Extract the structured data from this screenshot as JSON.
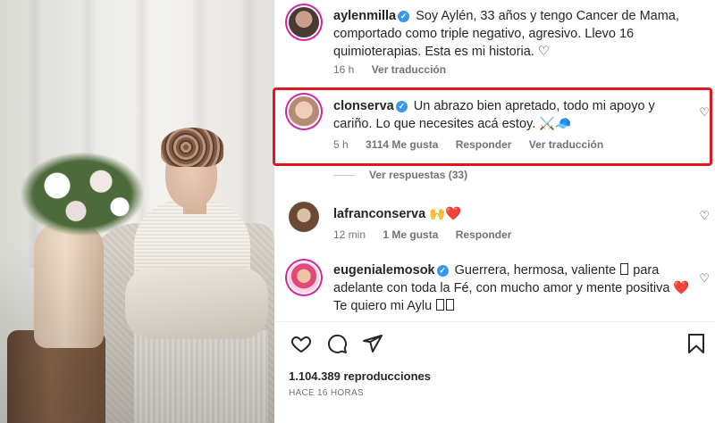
{
  "comments": [
    {
      "username": "aylenmilla",
      "verified": true,
      "text": "Soy Aylén, 33 años y tengo Cancer de Mama, comportado como triple negativo, agresivo. Llevo 16 quimioterapias. Esta es mi historia. ♡",
      "time": "16 h",
      "translate": "Ver traducción"
    },
    {
      "username": "clonserva",
      "verified": true,
      "text": "Un abrazo bien apretado, todo mi apoyo y cariño. Lo que necesites acá estoy. ⚔️🧢",
      "time": "5 h",
      "likes": "3114 Me gusta",
      "reply": "Responder",
      "translate": "Ver traducción",
      "replies_link": "Ver respuestas (33)"
    },
    {
      "username": "lafranconserva",
      "verified": false,
      "text": "🙌❤️",
      "time": "12 min",
      "likes": "1 Me gusta",
      "reply": "Responder"
    },
    {
      "username": "eugenialemosok",
      "verified": true,
      "text_main": "Guerrera, hermosa, valiente",
      "text_rest": "para adelante con toda la Fé, con mucho amor y mente positiva ❤️ Te quiero mi Aylu"
    }
  ],
  "stats": {
    "views": "1.104.389 reproducciones",
    "posted": "HACE 16 HORAS"
  },
  "icons": {
    "like": "heart-outline-icon",
    "comment": "speech-bubble-icon",
    "share": "paper-plane-icon",
    "save": "bookmark-icon"
  },
  "colors": {
    "highlight": "#e0161d",
    "verified": "#3897f0",
    "muted": "#737373"
  }
}
